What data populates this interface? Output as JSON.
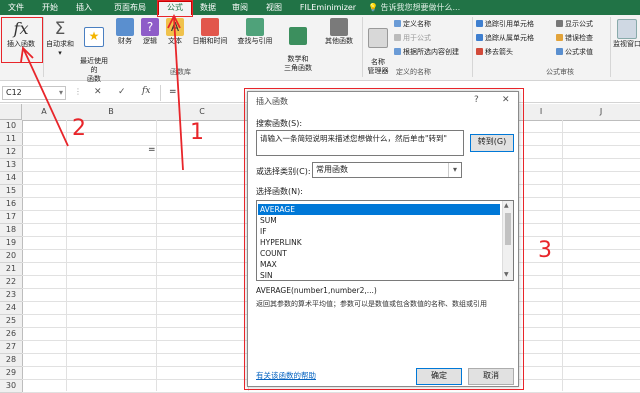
{
  "tabs": [
    "文件",
    "开始",
    "插入",
    "页面布局",
    "公式",
    "数据",
    "审阅",
    "视图",
    "FILEminimizer"
  ],
  "search_hint": "告诉我您想要做什么...",
  "ribbon": {
    "insert_function": "插入函数",
    "fx_symbol": "fx",
    "sigma": "Σ",
    "buttons": [
      "自动求和",
      "最近使用的\n函数",
      "财务",
      "逻辑",
      "文本",
      "日期和时间",
      "查找与引用",
      "数学和\n三角函数",
      "其他函数"
    ],
    "library_group": "函数库",
    "name_manager": "名称\n管理器",
    "defined_names": [
      "定义名称",
      "用于公式",
      "根据所选内容创建"
    ],
    "defined_names_group": "定义的名称",
    "audit": [
      "追踪引用单元格",
      "追踪从属单元格",
      "移去箭头"
    ],
    "audit2": [
      "显示公式",
      "错误检查",
      "公式求值"
    ],
    "audit_group": "公式审核",
    "watch_window": "监视窗口"
  },
  "formula_bar": {
    "name_box": "C12",
    "cancel": "✕",
    "enter": "✓",
    "fx": "fx",
    "content": "="
  },
  "grid": {
    "columns": [
      "A",
      "B",
      "C"
    ],
    "columns_right": [
      "I",
      "J"
    ],
    "rows": [
      "10",
      "11",
      "12",
      "13",
      "14",
      "15",
      "16",
      "17",
      "18",
      "19",
      "20",
      "21",
      "22",
      "23",
      "24",
      "25",
      "26",
      "27",
      "28",
      "29",
      "30"
    ],
    "cell_c12": "="
  },
  "dialog": {
    "title": "插入函数",
    "help": "?",
    "close": "✕",
    "search_label": "搜索函数(S):",
    "search_value": "请输入一条简短说明来描述您想做什么，然后单击\"转到\"",
    "go_button": "转到(G)",
    "category_label": "或选择类别(C):",
    "category_value": "常用函数",
    "function_label": "选择函数(N):",
    "functions": [
      "AVERAGE",
      "SUM",
      "IF",
      "HYPERLINK",
      "COUNT",
      "MAX",
      "SIN"
    ],
    "signature": "AVERAGE(number1,number2,...)",
    "description": "返回其参数的算术平均值；参数可以是数值或包含数值的名称、数组或引用",
    "help_link": "有关该函数的帮助",
    "ok": "确定",
    "cancel": "取消"
  },
  "annotations": [
    "1",
    "2",
    "3"
  ],
  "colors": {
    "excel_green": "#217346",
    "annotation_red": "#e8252a",
    "selection_blue": "#0078d7"
  }
}
